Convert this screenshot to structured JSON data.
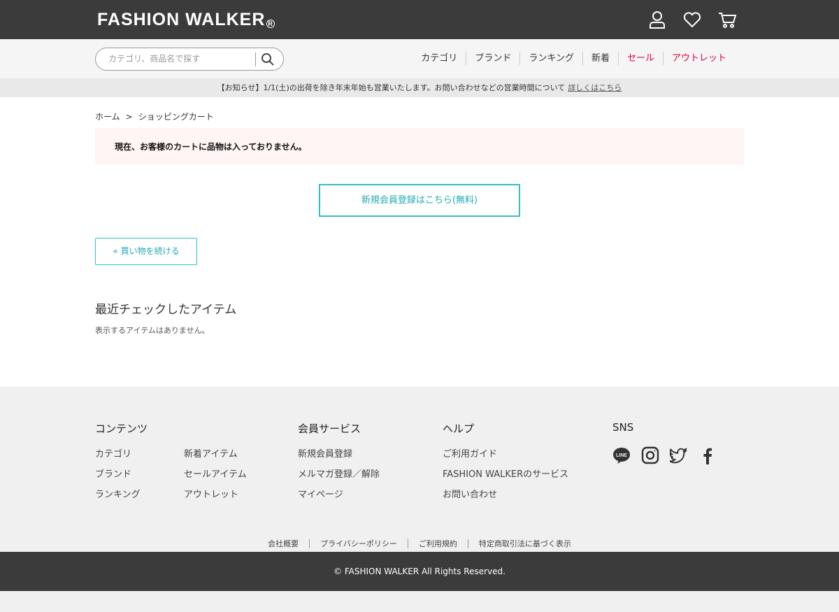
{
  "header": {
    "logo_text": "FASHION WALKER",
    "logo_mark": "R",
    "icons": [
      "user-icon",
      "heart-icon",
      "cart-icon"
    ]
  },
  "search": {
    "placeholder": "カテゴリ、商品名で探す",
    "value": ""
  },
  "nav": {
    "items": [
      {
        "label": "カテゴリ"
      },
      {
        "label": "ブランド"
      },
      {
        "label": "ランキング"
      },
      {
        "label": "新着"
      },
      {
        "label": "セール"
      },
      {
        "label": "アウトレット"
      }
    ],
    "accent_color": "#e0003c"
  },
  "notice": {
    "text": "【お知らせ】1/1(土)の出荷を除き年末年始も営業いたします。お問い合わせなどの営業時間について",
    "link": "詳しくはこちら"
  },
  "breadcrumb": {
    "home": "ホーム",
    "separator": ">",
    "current": "ショッピングカート"
  },
  "cart": {
    "empty_message": "現在、お客様のカートに品物は入っておりません。",
    "register_button": "新規会員登録はこちら(無料)",
    "continue_button": "« 買い物を続ける"
  },
  "recent": {
    "title": "最近チェックしたアイテム",
    "empty": "表示するアイテムはありません。"
  },
  "footer": {
    "contents": {
      "title": "コンテンツ",
      "col1": [
        "カテゴリ",
        "ブランド",
        "ランキング"
      ],
      "col2": [
        "新着アイテム",
        "セールアイテム",
        "アウトレット"
      ]
    },
    "member": {
      "title": "会員サービス",
      "items": [
        "新規会員登録",
        "メルマガ登録／解除",
        "マイページ"
      ]
    },
    "help": {
      "title": "ヘルプ",
      "items": [
        "ご利用ガイド",
        "FASHION WALKERのサービス",
        "お問い合わせ"
      ]
    },
    "sns": {
      "title": "SNS",
      "icons": [
        "line-icon",
        "instagram-icon",
        "twitter-icon",
        "facebook-icon"
      ]
    },
    "legal": [
      "会社概要",
      "プライバシーポリシー",
      "ご利用規約",
      "特定商取引法に基づく表示"
    ],
    "copyright": "© FASHION WALKER All Rights Reserved."
  },
  "colors": {
    "header_bg": "#3b3b3b",
    "teal": "#33bfc6",
    "alert_bg": "#fff5f4"
  }
}
